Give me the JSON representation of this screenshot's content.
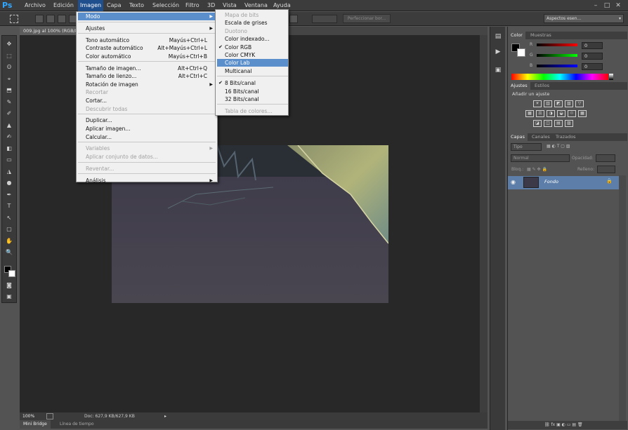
{
  "app": {
    "logo": "Ps"
  },
  "menubar": {
    "items": [
      "Archivo",
      "Edición",
      "Imagen",
      "Capa",
      "Texto",
      "Selección",
      "Filtro",
      "3D",
      "Vista",
      "Ventana",
      "Ayuda"
    ],
    "active": "Imagen",
    "window_buttons": [
      "–",
      "□",
      "✕"
    ]
  },
  "optionsbar": {
    "refine_button": "Perfeccionar bor...",
    "workspace": "Aspectos esen..."
  },
  "document": {
    "tab_title": "009.jpg al 100% (RGB/8)",
    "zoom": "100%",
    "doc_info": "Doc: 627,9 KB/627,9 KB"
  },
  "bottom_tabs": [
    "Mini Bridge",
    "Línea de tiempo"
  ],
  "imagen_menu": {
    "groups": [
      [
        {
          "label": "Modo",
          "submenu": true,
          "highlighted": true
        }
      ],
      [
        {
          "label": "Ajustes",
          "submenu": true
        }
      ],
      [
        {
          "label": "Tono automático",
          "shortcut": "Mayús+Ctrl+L"
        },
        {
          "label": "Contraste automático",
          "shortcut": "Alt+Mayús+Ctrl+L"
        },
        {
          "label": "Color automático",
          "shortcut": "Mayús+Ctrl+B"
        }
      ],
      [
        {
          "label": "Tamaño de imagen...",
          "shortcut": "Alt+Ctrl+Q"
        },
        {
          "label": "Tamaño de lienzo...",
          "shortcut": "Alt+Ctrl+C"
        },
        {
          "label": "Rotación de imagen",
          "submenu": true
        },
        {
          "label": "Recortar",
          "disabled": true
        },
        {
          "label": "Cortar..."
        },
        {
          "label": "Descubrir todas",
          "disabled": true
        }
      ],
      [
        {
          "label": "Duplicar..."
        },
        {
          "label": "Aplicar imagen..."
        },
        {
          "label": "Calcular..."
        }
      ],
      [
        {
          "label": "Variables",
          "submenu": true,
          "disabled": true
        },
        {
          "label": "Aplicar conjunto de datos...",
          "disabled": true
        }
      ],
      [
        {
          "label": "Reventar...",
          "disabled": true
        }
      ],
      [
        {
          "label": "Análisis",
          "submenu": true
        }
      ]
    ]
  },
  "modo_submenu": {
    "groups": [
      [
        {
          "label": "Mapa de bits",
          "disabled": true
        },
        {
          "label": "Escala de grises"
        },
        {
          "label": "Duotono",
          "disabled": true
        },
        {
          "label": "Color indexado..."
        },
        {
          "label": "Color RGB",
          "checked": true
        },
        {
          "label": "Color CMYK"
        },
        {
          "label": "Color Lab",
          "highlighted": true
        },
        {
          "label": "Multicanal"
        }
      ],
      [
        {
          "label": "8 Bits/canal",
          "checked": true
        },
        {
          "label": "16 Bits/canal"
        },
        {
          "label": "32 Bits/canal"
        }
      ],
      [
        {
          "label": "Tabla de colores...",
          "disabled": true
        }
      ]
    ]
  },
  "color_panel": {
    "tabs": [
      "Color",
      "Muestras"
    ],
    "channels": [
      {
        "label": "R",
        "value": "0"
      },
      {
        "label": "G",
        "value": "0"
      },
      {
        "label": "B",
        "value": "0"
      }
    ]
  },
  "adjust_panel": {
    "tabs": [
      "Ajustes",
      "Estilos"
    ],
    "heading": "Añadir un ajuste"
  },
  "layers_panel": {
    "tabs": [
      "Capas",
      "Canales",
      "Trazados"
    ],
    "filter": "Tipo",
    "blend_mode": "Normal",
    "opacity_label": "Opacidad:",
    "lock_label": "Bloq.:",
    "fill_label": "Relleno:",
    "layer_name": "Fondo"
  },
  "colors": {
    "menu_highlight": "#5a8fcc",
    "active_menu": "#1f4f8c",
    "layer_selected": "#5c7ea8"
  }
}
